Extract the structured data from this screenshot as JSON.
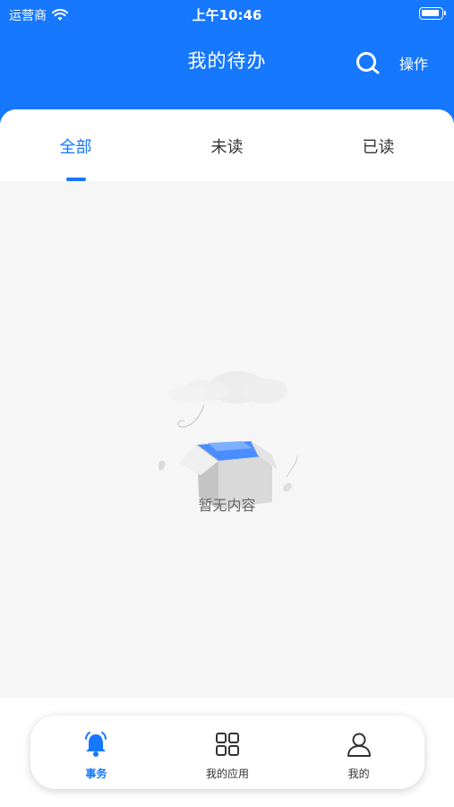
{
  "status_bar": {
    "carrier": "运营商",
    "time": "上午10:46"
  },
  "nav": {
    "title": "我的待办",
    "action_label": "操作",
    "search_icon": "search-icon"
  },
  "tabs": [
    {
      "label": "全部",
      "active": true
    },
    {
      "label": "未读",
      "active": false
    },
    {
      "label": "已读",
      "active": false
    }
  ],
  "empty_state": {
    "text": "暂无内容",
    "illustration": "empty-box-illustration"
  },
  "bottom_nav": [
    {
      "label": "事务",
      "icon": "bell-icon",
      "active": true
    },
    {
      "label": "我的应用",
      "icon": "grid-icon",
      "active": false
    },
    {
      "label": "我的",
      "icon": "user-icon",
      "active": false
    }
  ],
  "colors": {
    "primary": "#1677ff",
    "background": "#f6f6f6",
    "text": "#333333"
  }
}
